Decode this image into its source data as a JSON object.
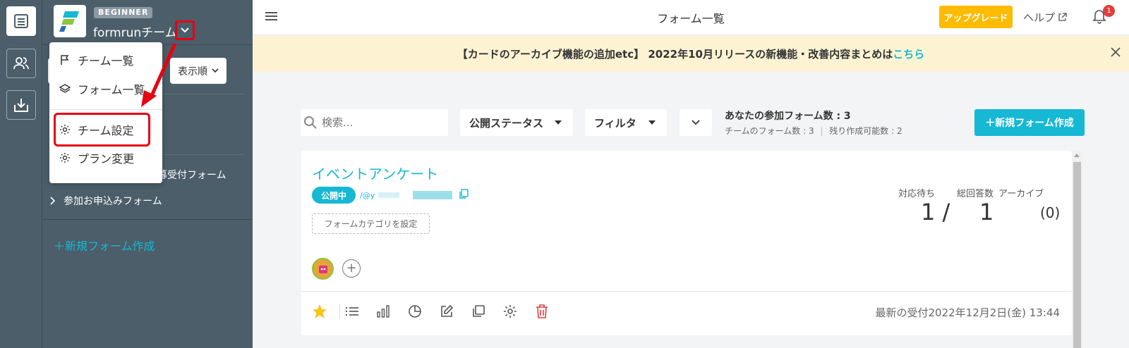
{
  "sidebar": {
    "plan_badge": "BEGINNER",
    "team_name": "formrunチーム",
    "sort_label": "表示順",
    "folders": [
      {
        "label": "募受付フォーム"
      },
      {
        "label": "参加お申込みフォーム"
      }
    ],
    "new_form_link": "＋新規フォーム作成"
  },
  "team_menu": {
    "items": [
      {
        "label": "チーム一覧",
        "icon": "flag-icon"
      },
      {
        "label": "フォーム一覧",
        "icon": "layers-icon"
      },
      {
        "label": "チーム設定",
        "icon": "gear-icon",
        "highlighted": true
      },
      {
        "label": "プラン変更",
        "icon": "gear-icon"
      }
    ]
  },
  "header": {
    "title": "フォーム一覧",
    "upgrade_label": "アップグレード",
    "help_label": "ヘルプ",
    "notification_count": "1"
  },
  "banner": {
    "text": "【カードのアーカイブ機能の追加etc】 2022年10月リリースの新機能・改善内容まとめは",
    "link_text": "こちら"
  },
  "toolbar": {
    "search_placeholder": "検索...",
    "status_filter": "公開ステータス",
    "filter": "フィルタ",
    "joined_forms": "あなたの参加フォーム数 : 3",
    "team_forms": "チームのフォーム数 : 3",
    "remaining": "残り作成可能数 : 2",
    "separator": "|",
    "new_form_button": "＋新規フォーム作成"
  },
  "form_card": {
    "title": "イベントアンケート",
    "status": "公開中",
    "url_prefix": "/@y",
    "category_button": "フォームカテゴリを設定",
    "stats": {
      "pending_label": "対応待ち",
      "total_label": "総回答数",
      "archive_label": "アーカイブ",
      "pending_value": "1 /",
      "total_value": "1",
      "archive_value": "(0)"
    },
    "last_received": "最新の受付2022年12月2日(金) 13:44"
  },
  "colors": {
    "accent": "#16b8d3",
    "sidebar": "#4b5e69",
    "upgrade": "#ffbb00",
    "highlight": "#e60012",
    "banner_bg": "#fdf3d3",
    "star": "#f5c518",
    "delete": "#e03e3e"
  }
}
